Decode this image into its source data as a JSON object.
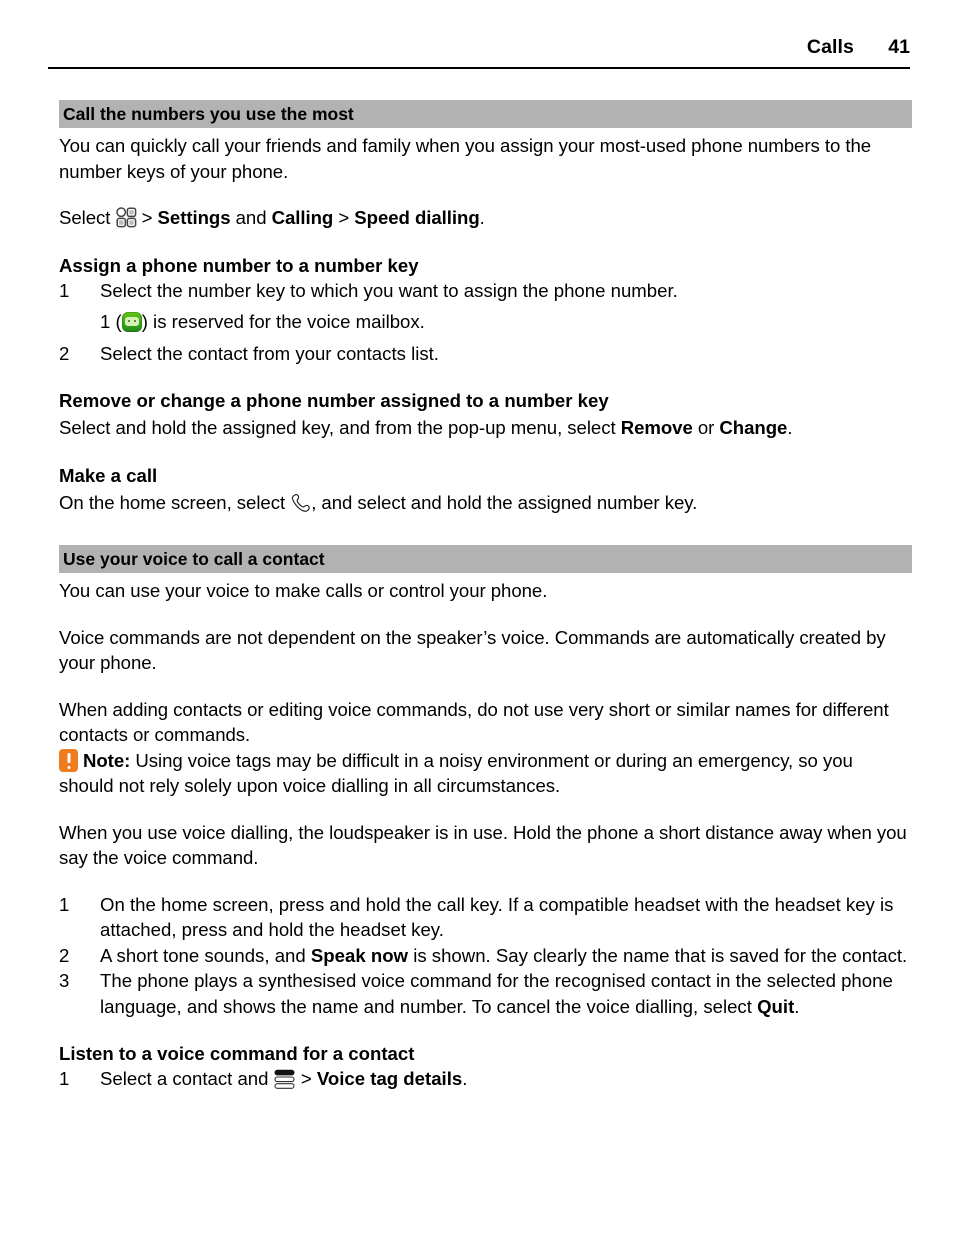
{
  "header": {
    "chapter": "Calls",
    "page_number": "41"
  },
  "sections": [
    {
      "band_title": "Call the numbers you use the most",
      "intro": "You can quickly call your friends and family when you assign your most-used phone numbers to the number keys of your phone.",
      "select_line": {
        "lead": "Select ",
        "icon": "grid-menu-icon",
        "sep1": " > ",
        "bold1": "Settings",
        "mid": " and ",
        "bold2": "Calling",
        "sep2": " > ",
        "bold3": "Speed dialling",
        "period": "."
      },
      "sub1": {
        "heading": "Assign a phone number to a number key",
        "step1": "Select the number key to which you want to assign the phone number.",
        "step1_num": "1",
        "substep_pre": "1 (",
        "substep_icon": "voicemail-icon",
        "substep_post": ") is reserved for the voice mailbox.",
        "step2_num": "2",
        "step2": "Select the contact from your contacts list."
      },
      "sub2": {
        "heading": "Remove or change a phone number assigned to a number key",
        "text_pre": "Select and hold the assigned key, and from the pop-up menu, select ",
        "bold1": "Remove",
        "text_mid": " or ",
        "bold2": "Change",
        "text_post": "."
      },
      "sub3": {
        "heading": "Make a call",
        "text_pre": "On the home screen, select ",
        "icon": "phone-handset-icon",
        "text_post": ", and select and hold the assigned number key."
      }
    },
    {
      "band_title": "Use your voice to call a contact",
      "para1": "You can use your voice to make calls or control your phone.",
      "para2": "Voice commands are not dependent on the speaker’s voice. Commands are automatically created by your phone.",
      "para3": "When adding contacts or editing voice commands, do not use very short or similar names for different contacts or commands.",
      "note": {
        "icon": "note-warning-icon",
        "label": "Note:",
        "text": " Using voice tags may be difficult in a noisy environment or during an emergency, so you should not rely solely upon voice dialling in all circumstances."
      },
      "para4": "When you use voice dialling, the loudspeaker is in use. Hold the phone a short distance away when you say the voice command.",
      "steps": [
        {
          "num": "1",
          "text": "On the home screen, press and hold the call key. If a compatible headset with the headset key is attached, press and hold the headset key."
        },
        {
          "num": "2",
          "pre": "A short tone sounds, and ",
          "bold": "Speak now",
          "post": " is shown. Say clearly the name that is saved for the contact."
        },
        {
          "num": "3",
          "pre": "The phone plays a synthesised voice command for the recognised contact in the selected phone language, and shows the name and number. To cancel the voice dialling, select ",
          "bold": "Quit",
          "post": "."
        }
      ],
      "sub1": {
        "heading": "Listen to a voice command for a contact",
        "step_num": "1",
        "text_pre": "Select a contact and ",
        "icon": "options-list-icon",
        "sep": " > ",
        "bold": "Voice tag details",
        "text_post": "."
      }
    }
  ],
  "colors": {
    "band_gray": "#b2b2b2",
    "note_orange": "#ef7d1e",
    "voicemail_green": "#4fb317",
    "text": "#000000"
  }
}
